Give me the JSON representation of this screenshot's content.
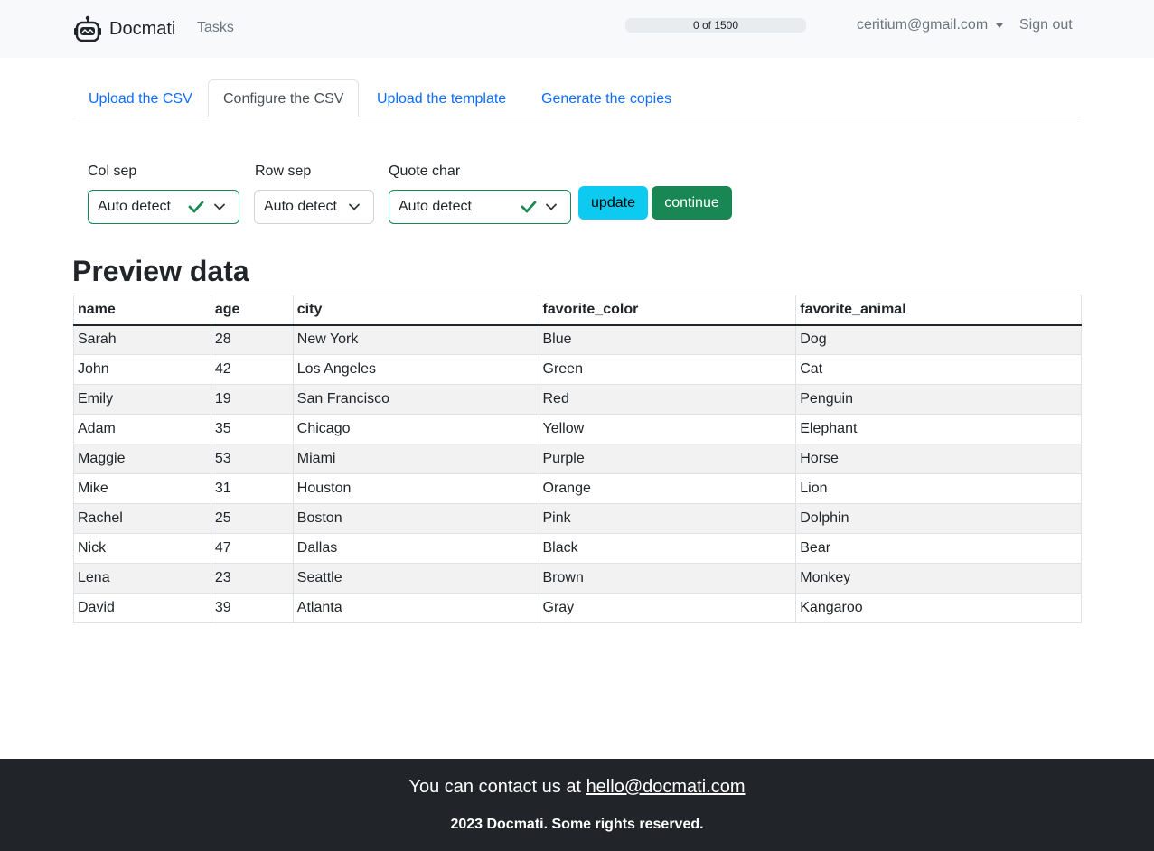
{
  "navbar": {
    "brand": "Docmati",
    "tasks_link": "Tasks",
    "progress_text": "0 of 1500",
    "progress_fraction": 0,
    "user_email": "ceritium@gmail.com",
    "sign_out": "Sign out"
  },
  "tabs": [
    {
      "label": "Upload the CSV",
      "active": false
    },
    {
      "label": "Configure the CSV",
      "active": true
    },
    {
      "label": "Upload the template",
      "active": false
    },
    {
      "label": "Generate the copies",
      "active": false
    }
  ],
  "form": {
    "col_sep": {
      "label": "Col sep",
      "value": "Auto detect",
      "valid": true
    },
    "row_sep": {
      "label": "Row sep",
      "value": "Auto detect",
      "valid": false
    },
    "quote_char": {
      "label": "Quote char",
      "value": "Auto detect",
      "valid": true
    },
    "update_button": "update",
    "continue_button": "continue"
  },
  "preview": {
    "title": "Preview data",
    "columns": [
      "name",
      "age",
      "city",
      "favorite_color",
      "favorite_animal"
    ],
    "rows": [
      [
        "Sarah",
        "28",
        "New York",
        "Blue",
        "Dog"
      ],
      [
        "John",
        "42",
        "Los Angeles",
        "Green",
        "Cat"
      ],
      [
        "Emily",
        "19",
        "San Francisco",
        "Red",
        "Penguin"
      ],
      [
        "Adam",
        "35",
        "Chicago",
        "Yellow",
        "Elephant"
      ],
      [
        "Maggie",
        "53",
        "Miami",
        "Purple",
        "Horse"
      ],
      [
        "Mike",
        "31",
        "Houston",
        "Orange",
        "Lion"
      ],
      [
        "Rachel",
        "25",
        "Boston",
        "Pink",
        "Dolphin"
      ],
      [
        "Nick",
        "47",
        "Dallas",
        "Black",
        "Bear"
      ],
      [
        "Lena",
        "23",
        "Seattle",
        "Brown",
        "Monkey"
      ],
      [
        "David",
        "39",
        "Atlanta",
        "Gray",
        "Kangaroo"
      ]
    ]
  },
  "footer": {
    "contact_prefix": "You can contact us at ",
    "contact_email": "hello@docmati.com",
    "copyright": "2023 Docmati. Some rights reserved."
  },
  "colors": {
    "link": "#0d6efd",
    "success": "#198754",
    "info": "#0dcaf0",
    "footer_bg": "#212529"
  }
}
